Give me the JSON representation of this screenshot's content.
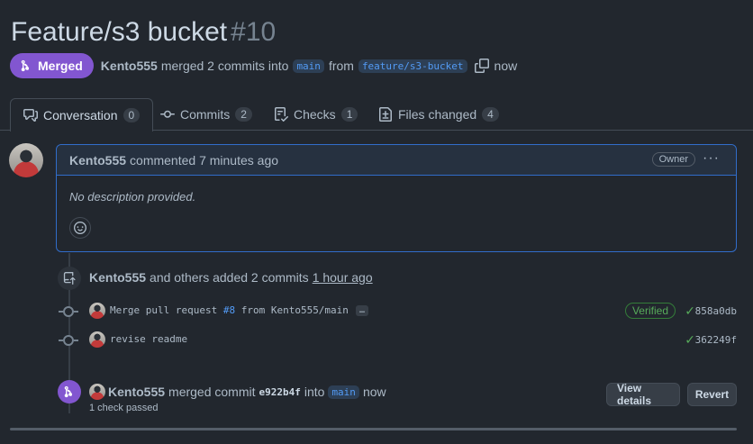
{
  "pr": {
    "title": "Feature/s3 bucket",
    "number": "#10",
    "state": "Merged",
    "author": "Kento555",
    "merge_text": "merged 2 commits into",
    "base_branch": "main",
    "from_text": "from",
    "head_branch": "feature/s3-bucket",
    "time": "now"
  },
  "tabs": [
    {
      "label": "Conversation",
      "count": "0",
      "icon": "comment-discussion-icon"
    },
    {
      "label": "Commits",
      "count": "2",
      "icon": "git-commit-icon"
    },
    {
      "label": "Checks",
      "count": "1",
      "icon": "checklist-icon"
    },
    {
      "label": "Files changed",
      "count": "4",
      "icon": "file-diff-icon"
    }
  ],
  "comment": {
    "author": "Kento555",
    "action": "commented 7 minutes ago",
    "role": "Owner",
    "body": "No description provided.",
    "menu": "···"
  },
  "commits_header": {
    "author": "Kento555",
    "text": "and others added 2 commits",
    "time": "1 hour ago"
  },
  "commits": [
    {
      "message_prefix": "Merge pull request",
      "pr_ref": "#8",
      "message_suffix": "from Kento555/main",
      "more": "…",
      "verified": "Verified",
      "check": "✓",
      "sha": "858a0db"
    },
    {
      "message": "revise readme",
      "check": "✓",
      "sha": "362249f"
    }
  ],
  "merge_event": {
    "author": "Kento555",
    "text": "merged commit",
    "sha": "e922b4f",
    "into": "into",
    "branch": "main",
    "time": "now",
    "checks": "1 check passed",
    "view_details": "View details",
    "revert": "Revert"
  },
  "colors": {
    "background": "#22272e",
    "merged_purple": "#8256d0",
    "accent_blue": "#316dca",
    "success_green": "#57ab5a"
  }
}
